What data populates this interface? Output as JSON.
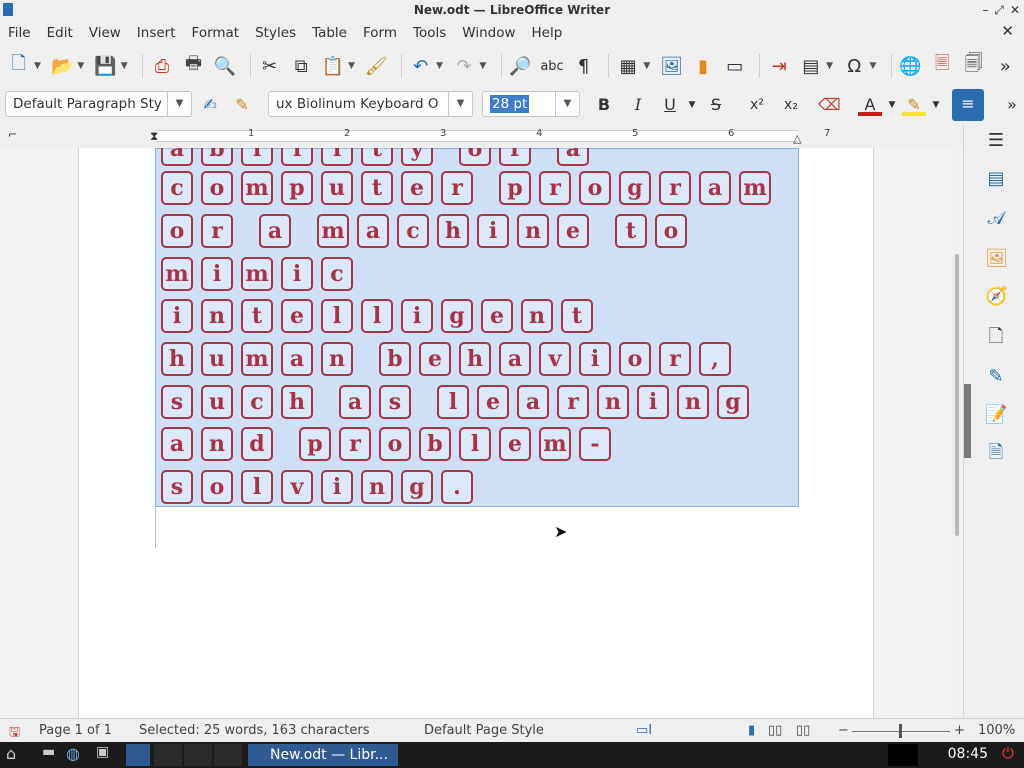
{
  "window": {
    "title": "New.odt — LibreOffice Writer",
    "controls": [
      "–",
      "⤢",
      "✕"
    ]
  },
  "menu": [
    "File",
    "Edit",
    "View",
    "Insert",
    "Format",
    "Styles",
    "Table",
    "Form",
    "Tools",
    "Window",
    "Help"
  ],
  "menu_close": "✕",
  "toolbar2": {
    "paragraph_style": "Default Paragraph Sty",
    "font_name": "ux Biolinum Keyboard O",
    "font_size": "28 pt",
    "bold": "B",
    "italic": "I",
    "underline": "U",
    "strike": "S",
    "superscript": "x²",
    "subscript": "x₂"
  },
  "ruler_numbers": [
    "1",
    "2",
    "3",
    "4",
    "5",
    "6",
    "7"
  ],
  "document_lines": [
    "a b i l i t y  o f  a",
    "c o m p u t e r  p r o g r a m",
    "o r  a  m a c h i n e  t o",
    "m i m i c",
    "i n t e l l i g e n t",
    "h u m a n  b e h a v i o r ,",
    "s u c h  a s  l e a r n i n g",
    "a n d  p r o b l e m -",
    "s o l v i n g ."
  ],
  "status": {
    "page": "Page 1 of 1",
    "selection": "Selected: 25 words, 163 characters",
    "page_style": "Default Page Style",
    "zoom": "100%"
  },
  "taskbar": {
    "task": "New.odt — Libr...",
    "clock": "08:45"
  },
  "colors": {
    "tile": "#a83246",
    "selection": "#cfe0f5",
    "accent": "#2b6cb0"
  }
}
